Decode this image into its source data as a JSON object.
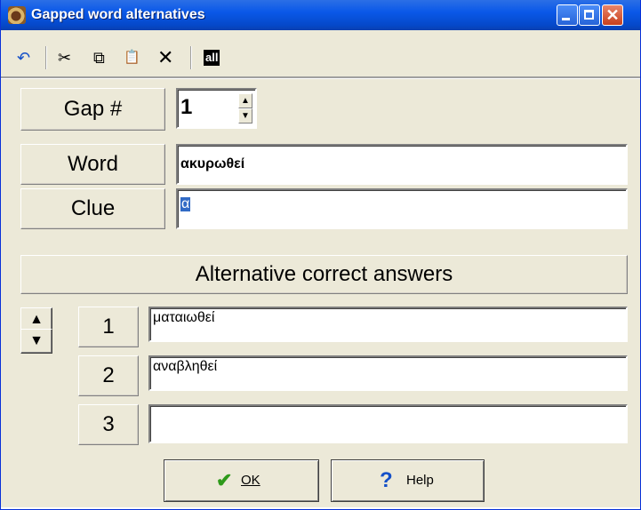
{
  "window": {
    "title": "Gapped word alternatives",
    "buttons": {
      "minimize": "minimize-icon",
      "maximize": "maximize-icon",
      "close": "close-icon"
    }
  },
  "toolbar": {
    "undo_icon": "↶",
    "cut_icon": "✂",
    "copy_icon": "⧉",
    "paste_icon": "📋",
    "delete_icon": "✕",
    "all_label": "all"
  },
  "gap": {
    "label": "Gap #",
    "value": "1"
  },
  "word": {
    "label": "Word",
    "value": "ακυρωθεί"
  },
  "clue": {
    "label": "Clue",
    "value": "α"
  },
  "alternatives": {
    "header": "Alternative correct answers",
    "rows": [
      {
        "number": "1",
        "value": "ματαιωθεί"
      },
      {
        "number": "2",
        "value": "αναβληθεί"
      },
      {
        "number": "3",
        "value": ""
      }
    ]
  },
  "buttons": {
    "ok": "OK",
    "help": "Help"
  },
  "colors": {
    "titlebar": "#0a58e8",
    "face": "#ece9d8",
    "ok_check": "#2e9a1a",
    "help_mark": "#1450c8"
  }
}
